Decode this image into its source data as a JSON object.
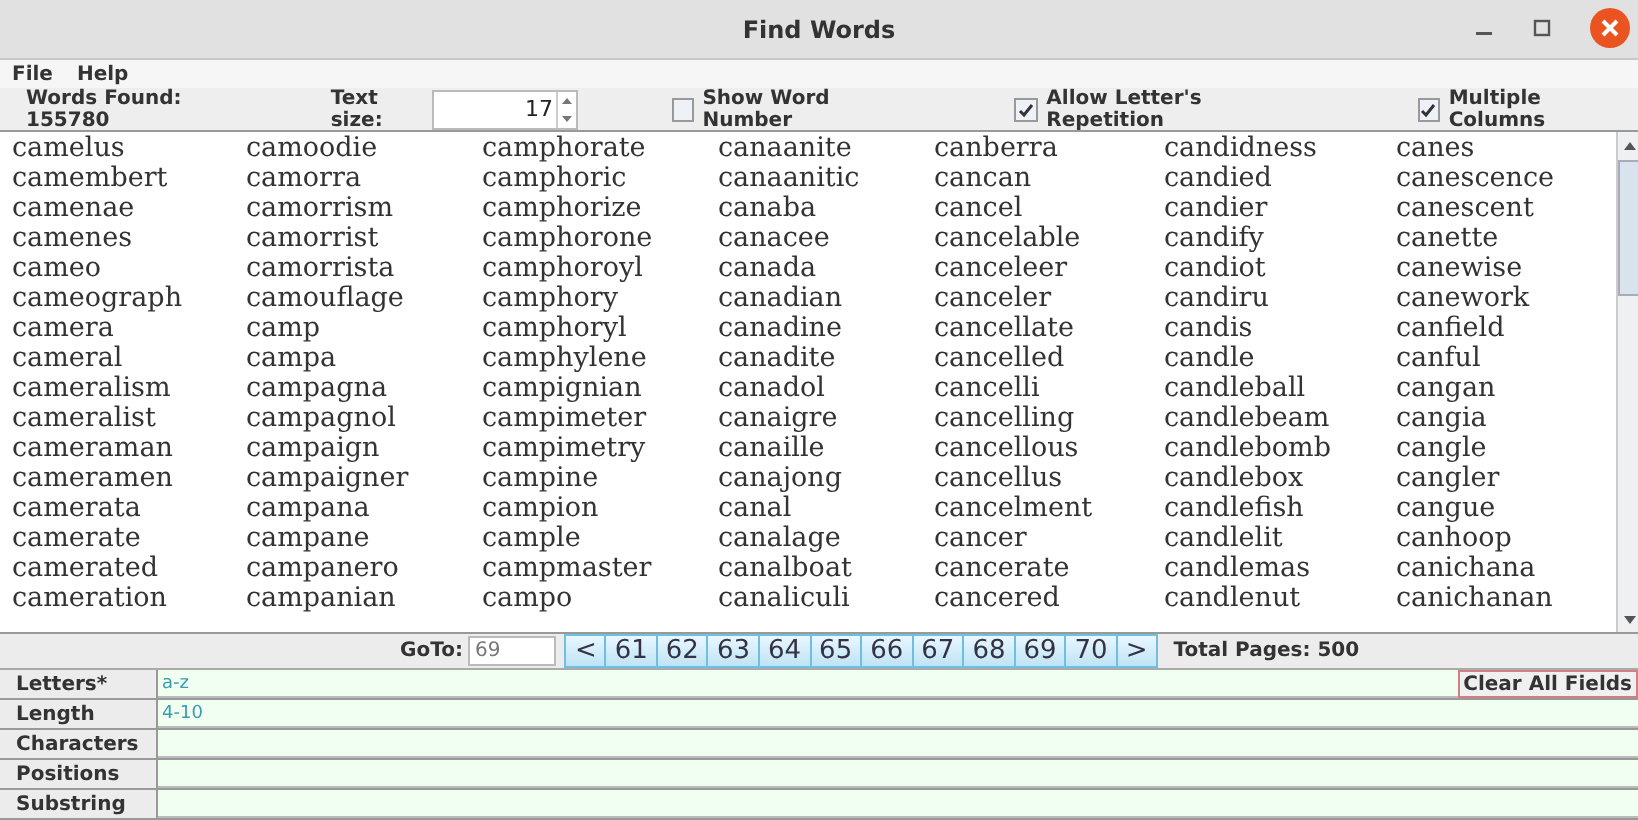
{
  "window": {
    "title": "Find Words"
  },
  "menu": [
    "File",
    "Help"
  ],
  "toolbar": {
    "words_found": "Words Found: 155780",
    "text_size_label": "Text size:",
    "text_size": "17",
    "checkboxes": [
      {
        "label": "Show Word Number",
        "checked": false
      },
      {
        "label": "Allow Letter's Repetition",
        "checked": true
      },
      {
        "label": "Multiple Columns",
        "checked": true
      }
    ]
  },
  "word_columns": [
    [
      "camelus",
      "camembert",
      "camenae",
      "camenes",
      "cameo",
      "cameograph",
      "camera",
      "cameral",
      "cameralism",
      "cameralist",
      "cameraman",
      "cameramen",
      "camerata",
      "camerate",
      "camerated",
      "cameration"
    ],
    [
      "camoodie",
      "camorra",
      "camorrism",
      "camorrist",
      "camorrista",
      "camouflage",
      "camp",
      "campa",
      "campagna",
      "campagnol",
      "campaign",
      "campaigner",
      "campana",
      "campane",
      "campanero",
      "campanian"
    ],
    [
      "camphorate",
      "camphoric",
      "camphorize",
      "camphorone",
      "camphoroyl",
      "camphory",
      "camphoryl",
      "camphylene",
      "campignian",
      "campimeter",
      "campimetry",
      "campine",
      "campion",
      "cample",
      "campmaster",
      "campo"
    ],
    [
      "canaanite",
      "canaanitic",
      "canaba",
      "canacee",
      "canada",
      "canadian",
      "canadine",
      "canadite",
      "canadol",
      "canaigre",
      "canaille",
      "canajong",
      "canal",
      "canalage",
      "canalboat",
      "canaliculi"
    ],
    [
      "canberra",
      "cancan",
      "cancel",
      "cancelable",
      "canceleer",
      "canceler",
      "cancellate",
      "cancelled",
      "cancelli",
      "cancelling",
      "cancellous",
      "cancellus",
      "cancelment",
      "cancer",
      "cancerate",
      "cancered"
    ],
    [
      "candidness",
      "candied",
      "candier",
      "candify",
      "candiot",
      "candiru",
      "candis",
      "candle",
      "candleball",
      "candlebeam",
      "candlebomb",
      "candlebox",
      "candlefish",
      "candlelit",
      "candlemas",
      "candlenut"
    ],
    [
      "canes",
      "canescence",
      "canescent",
      "canette",
      "canewise",
      "canework",
      "canfield",
      "canful",
      "cangan",
      "cangia",
      "cangle",
      "cangler",
      "cangue",
      "canhoop",
      "canichana",
      "canichanan"
    ]
  ],
  "pager": {
    "goto_label": "GoTo:",
    "goto_value": "69",
    "prev": "<",
    "pages": [
      "61",
      "62",
      "63",
      "64",
      "65",
      "66",
      "67",
      "68",
      "69",
      "70"
    ],
    "next": ">",
    "total": "Total Pages: 500"
  },
  "fields": [
    {
      "label": "Letters*",
      "value": "a-z"
    },
    {
      "label": "Length",
      "value": "4-10"
    },
    {
      "label": "Characters"
    },
    {
      "label": "Positions"
    },
    {
      "label": "Substring"
    }
  ],
  "clear_button": "Clear All Fields"
}
